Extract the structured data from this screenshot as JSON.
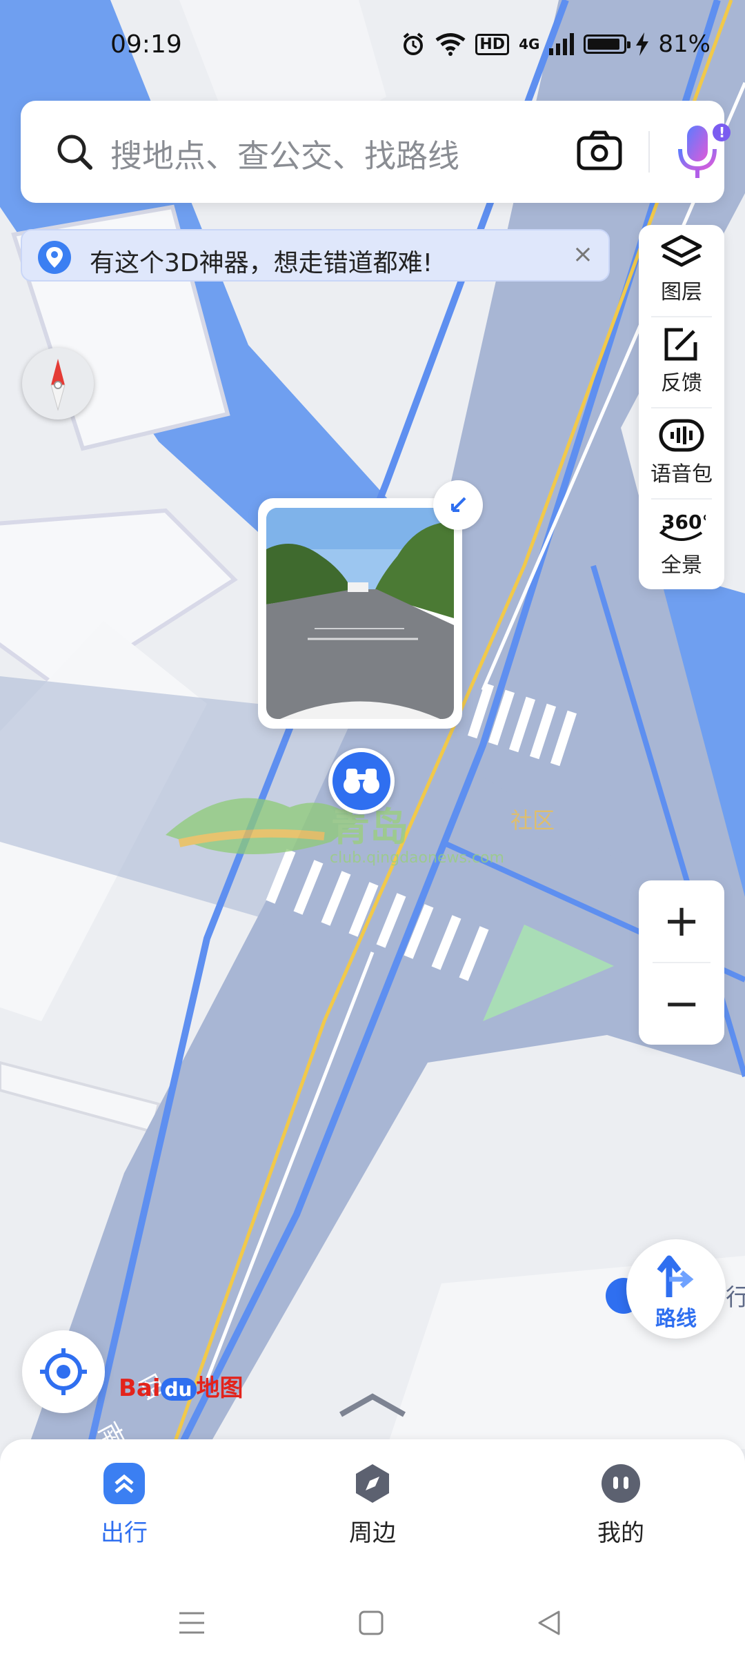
{
  "status_bar": {
    "time": "09:19",
    "hd": "HD",
    "network": "4G",
    "battery": "81%",
    "battery_level": 0.81
  },
  "search": {
    "placeholder": "搜地点、查公交、找路线",
    "camera_icon": "camera-icon",
    "voice_icon": "microphone-icon"
  },
  "banner": {
    "text": "有这个3D神器，想走错道都难!",
    "close": "×"
  },
  "toolbar": {
    "items": [
      {
        "icon": "layers-icon",
        "label": "图层"
      },
      {
        "icon": "feedback-icon",
        "label": "反馈"
      },
      {
        "icon": "voice-pack-icon",
        "label": "语音包"
      },
      {
        "icon": "panorama-icon",
        "badge": "360°",
        "label": "全景"
      }
    ]
  },
  "zoom": {
    "in": "+",
    "out": "−"
  },
  "route_button": {
    "label": "路线"
  },
  "map": {
    "road_label": "四",
    "road_label_2": "南",
    "logo_text_1": "Bai",
    "logo_text_2": "du",
    "logo_text_3": "地图",
    "right_edge_text": "行"
  },
  "watermark": {
    "title": "青岛",
    "sub": "社区",
    "url": "club.qingdaonews.com"
  },
  "bottom_nav": {
    "tabs": [
      {
        "label": "出行",
        "active": true,
        "icon": "travel-icon",
        "color": "#2f6ff0"
      },
      {
        "label": "周边",
        "active": false,
        "icon": "compass-icon",
        "color": "#555a63"
      },
      {
        "label": "我的",
        "active": false,
        "icon": "profile-icon",
        "color": "#555a63"
      }
    ]
  },
  "system_nav": {
    "menu": "menu-icon",
    "home": "home-icon",
    "back": "back-icon"
  },
  "colors": {
    "accent": "#2f6ff0",
    "road": "#a8b6d4",
    "water": "#6d9ef2",
    "building": "#f6f7f9"
  }
}
